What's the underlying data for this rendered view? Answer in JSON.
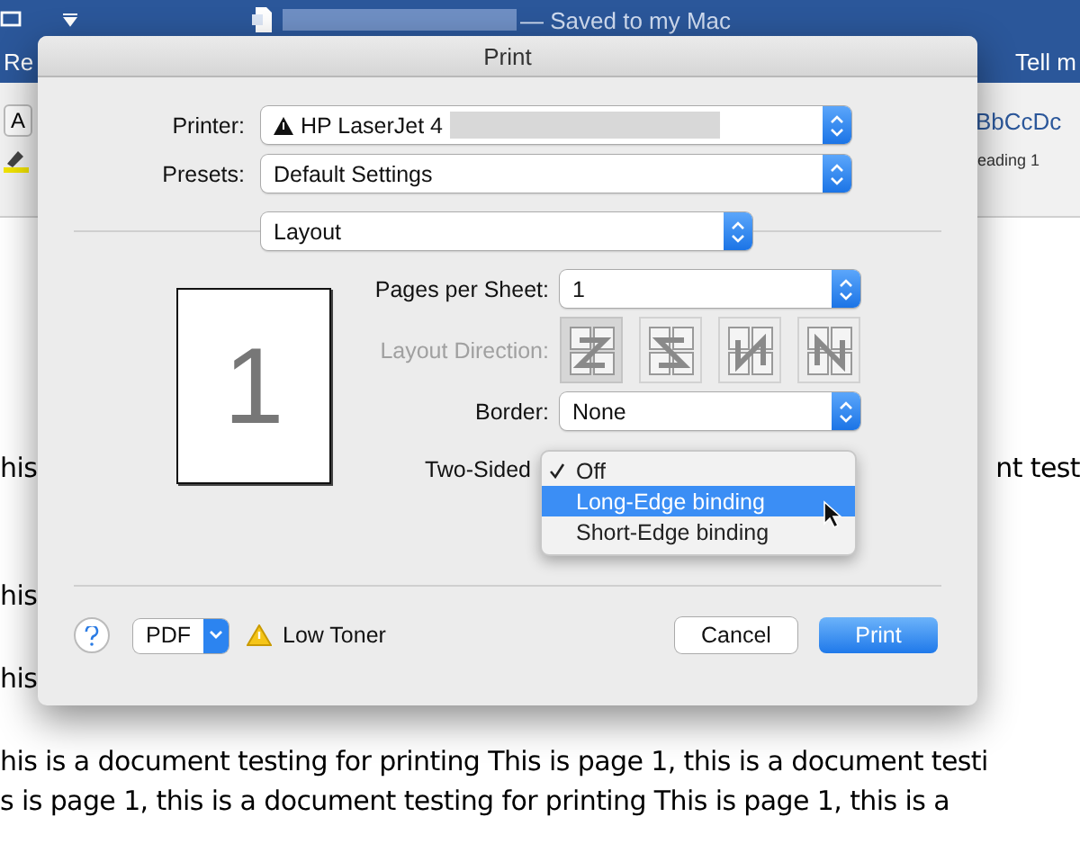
{
  "app": {
    "title_suffix": "— Saved to my Mac",
    "ribbon_tab": "Re",
    "tell_me": "Tell m",
    "font_button": "A",
    "style_preview": "BbCcDc",
    "style_name": "eading 1"
  },
  "document": {
    "lines": [
      {
        "left": "his",
        "right": "nt test"
      },
      {
        "left": "his"
      },
      {
        "left": "his"
      },
      {
        "left": "his is a document testing for printing This is page 1, this is a document testi"
      },
      {
        "left": "s is page 1, this is a document testing for printing This is page 1, this is a"
      }
    ]
  },
  "dialog": {
    "title": "Print",
    "printer": {
      "label": "Printer:",
      "value": "HP LaserJet 4"
    },
    "presets": {
      "label": "Presets:",
      "value": "Default Settings"
    },
    "section": {
      "value": "Layout"
    },
    "preview": {
      "page": "1"
    },
    "pages_per_sheet": {
      "label": "Pages per Sheet:",
      "value": "1"
    },
    "layout_direction": {
      "label": "Layout Direction:",
      "disabled": true,
      "options": [
        {
          "kind": "z",
          "selected": true
        },
        {
          "kind": "s",
          "selected": false
        },
        {
          "kind": "n-rev",
          "selected": false
        },
        {
          "kind": "n",
          "selected": false
        }
      ]
    },
    "border": {
      "label": "Border:",
      "value": "None"
    },
    "two_sided": {
      "label": "Two-Sided",
      "menu": [
        {
          "label": "Off",
          "checked": true,
          "selected": false
        },
        {
          "label": "Long-Edge binding",
          "checked": false,
          "selected": true
        },
        {
          "label": "Short-Edge binding",
          "checked": false,
          "selected": false
        }
      ]
    },
    "pdf": {
      "label": "PDF"
    },
    "warning": {
      "text": "Low Toner"
    },
    "buttons": [
      {
        "label": "Cancel",
        "kind": "secondary"
      },
      {
        "label": "Print",
        "kind": "primary"
      }
    ]
  }
}
